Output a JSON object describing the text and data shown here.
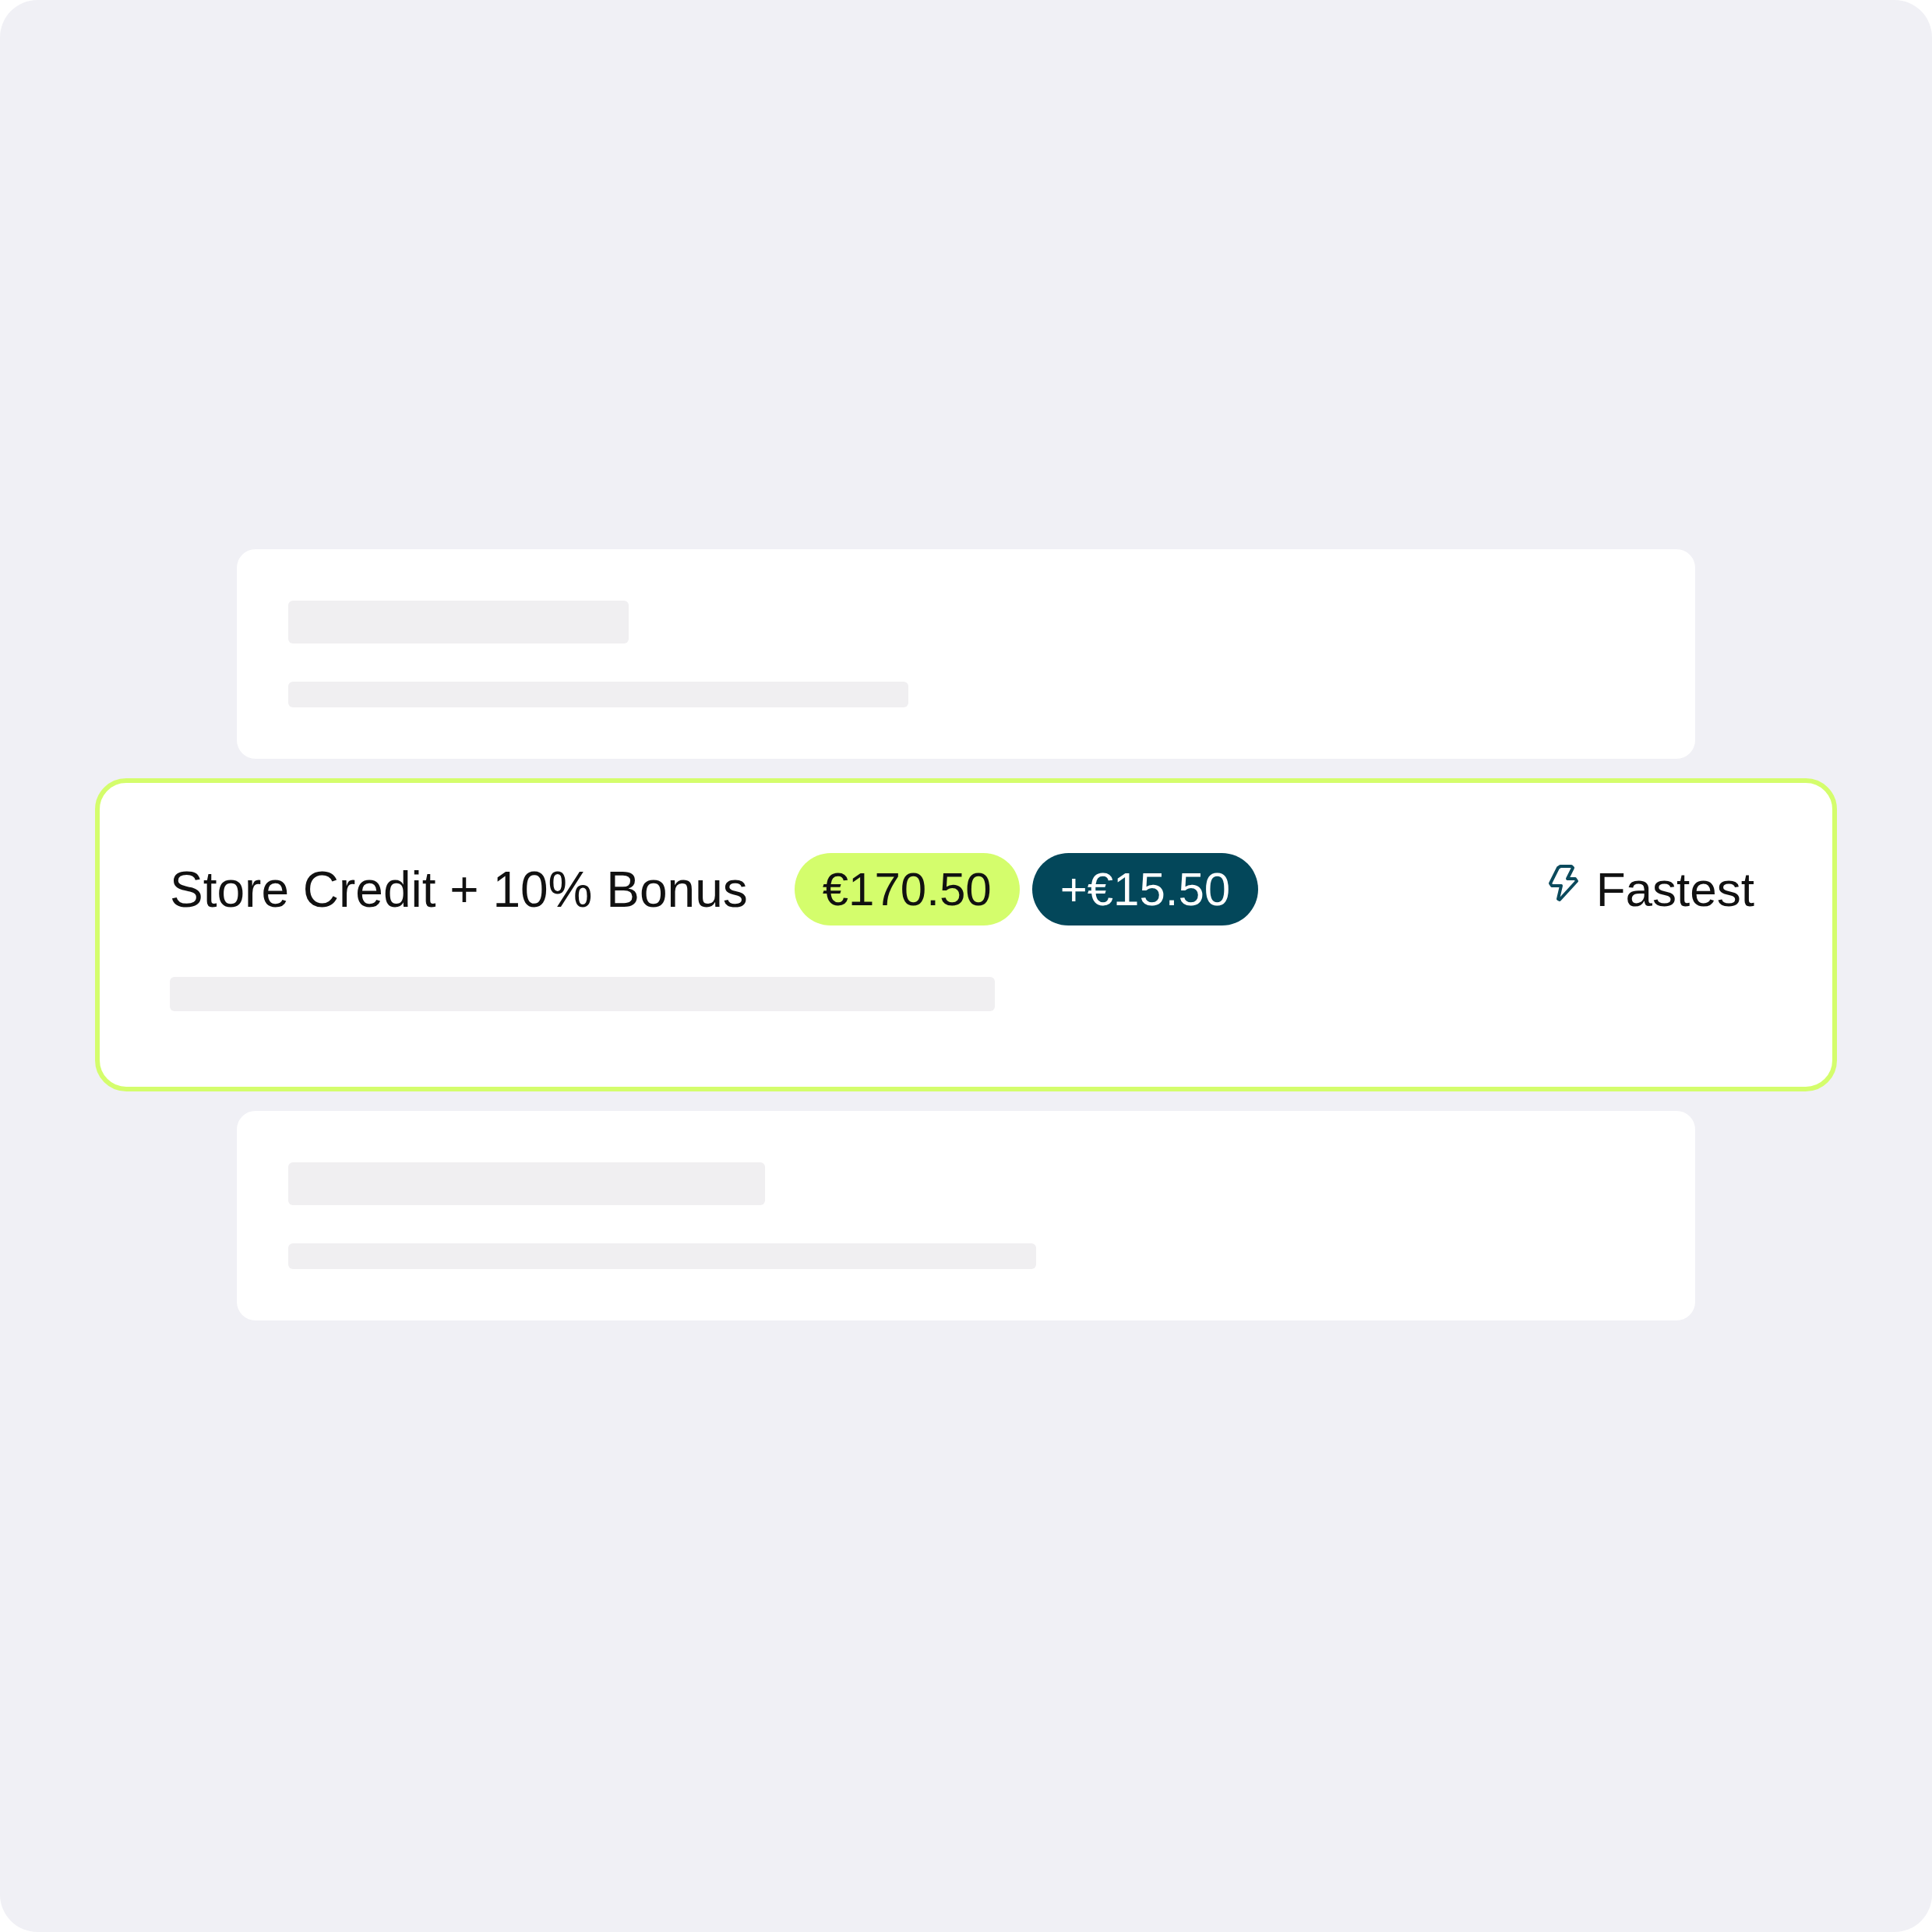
{
  "cards": [
    {
      "kind": "placeholder",
      "selected": false
    },
    {
      "kind": "option",
      "selected": true,
      "title": "Store Credit + 10% Bonus",
      "price": "€170.50",
      "bonus": "+€15.50",
      "tag": "Fastest"
    },
    {
      "kind": "placeholder",
      "selected": false
    }
  ]
}
